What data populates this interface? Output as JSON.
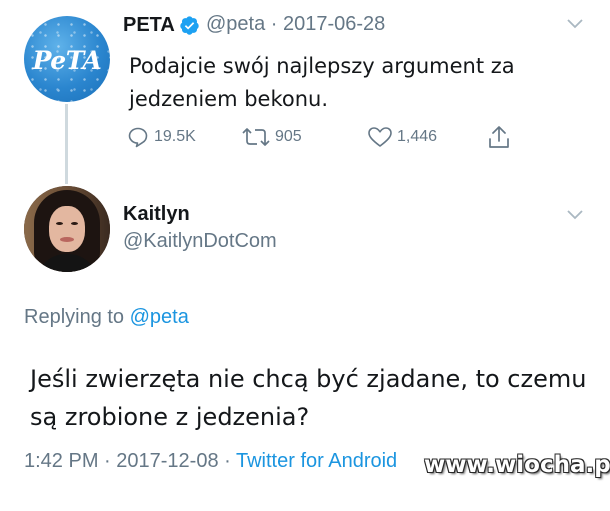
{
  "tweet1": {
    "avatar_logo_text": "PeTA",
    "name": "PETA",
    "verified": true,
    "handle_date": "@peta · 2017-06-28",
    "text": "Podajcie swój najlepszy argument za jedzeniem bekonu.",
    "actions": {
      "reply_icon": "reply-icon",
      "reply_count": "19.5K",
      "retweet_icon": "retweet-icon",
      "retweet_count": "905",
      "like_icon": "heart-icon",
      "like_count": "1,446",
      "share_icon": "share-icon"
    }
  },
  "tweet2": {
    "name": "Kaitlyn",
    "handle": "@KaitlynDotCom",
    "replying_prefix": "Replying to ",
    "replying_mention": "@peta",
    "text": "Jeśli zwierzęta nie chcą być zjadane, to czemu są zrobione z jedzenia?",
    "time_date": "1:42 PM · 2017-12-08 · ",
    "source": "Twitter for Android"
  },
  "watermark": "www.wiocha.pl",
  "colors": {
    "link": "#1b95e0",
    "muted": "#657786",
    "text": "#14171a",
    "verified": "#1da1f2"
  }
}
